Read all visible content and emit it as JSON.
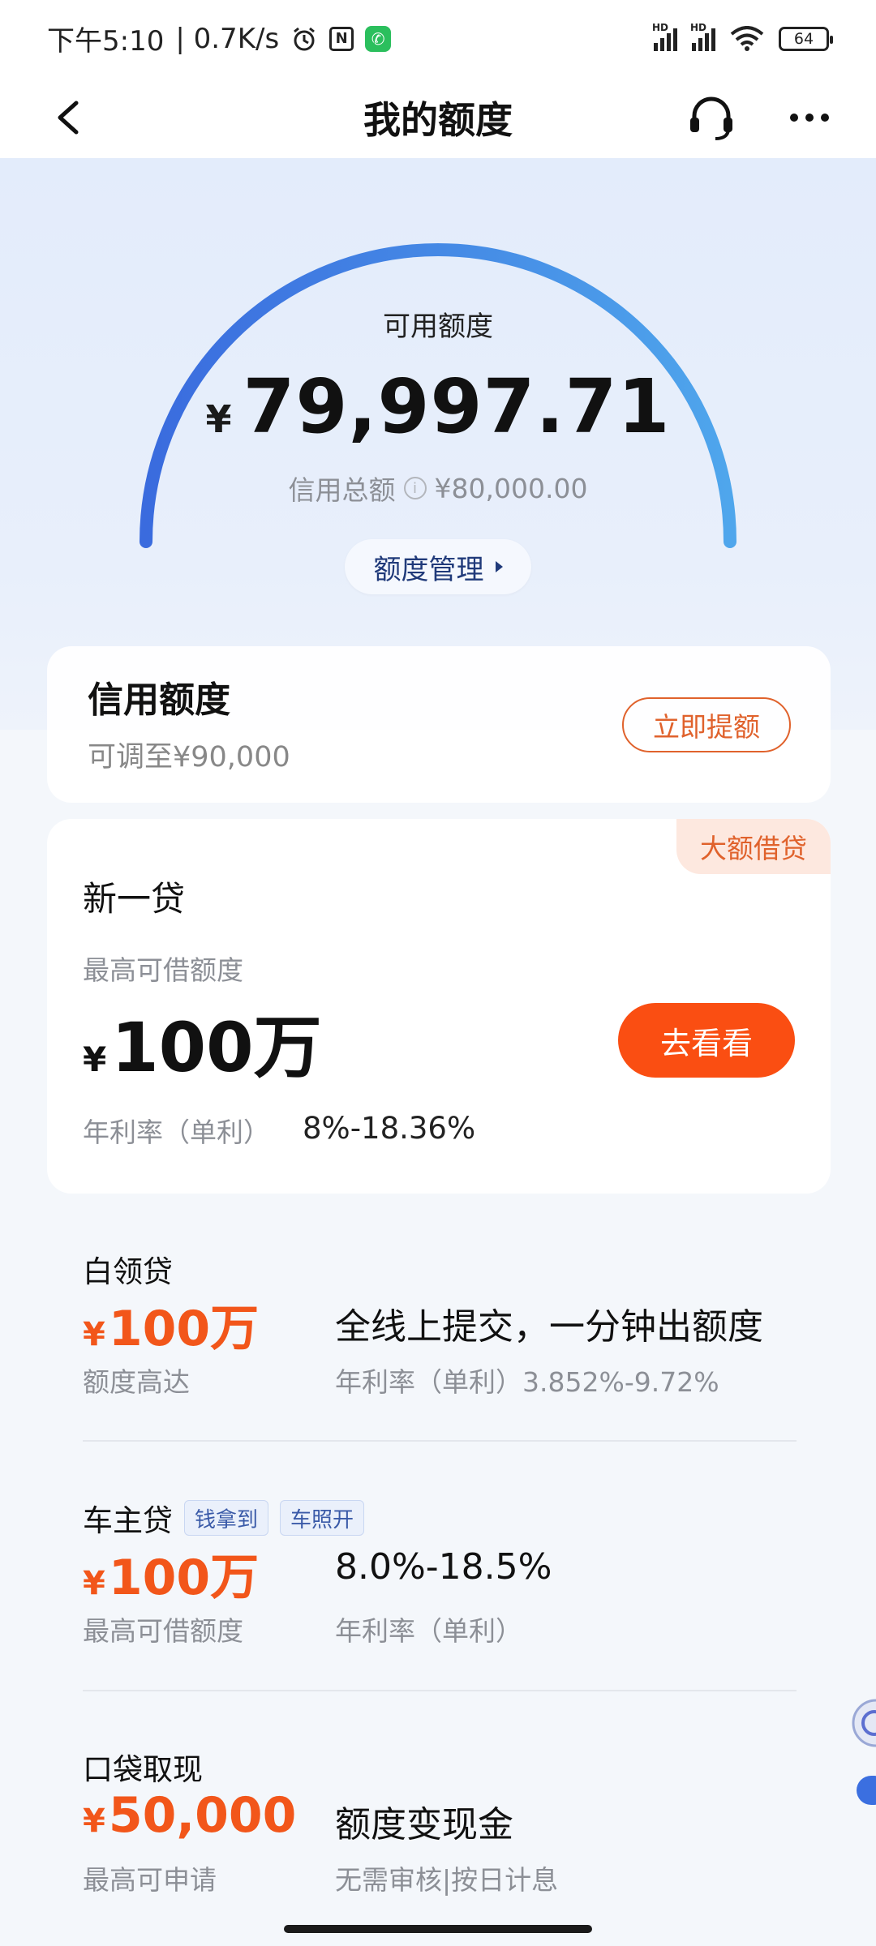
{
  "status_bar": {
    "time": "下午5:10",
    "net_speed": "| 0.7K/s",
    "signal_label": "HD",
    "battery": "64"
  },
  "nav": {
    "title": "我的额度"
  },
  "quota": {
    "label": "可用额度",
    "currency": "¥",
    "available": "79,997.71",
    "total_label": "信用总额",
    "total_value": "¥80,000.00",
    "manage_label": "额度管理",
    "gauge_colors": [
      "#3a6bde",
      "#4fa6ec"
    ]
  },
  "credit": {
    "title": "信用额度",
    "sub": "可调至¥90,000",
    "button": "立即提额"
  },
  "featured_loan": {
    "badge": "大额借贷",
    "title": "新一贷",
    "sub": "最高可借额度",
    "currency": "¥",
    "amount": "100万",
    "rate_label": "年利率（单利）",
    "rate": "8%-18.36%",
    "button": "去看看"
  },
  "products": [
    {
      "title": "白领贷",
      "currency": "¥",
      "amount": "100万",
      "left_sub": "额度高达",
      "desc": "全线上提交，一分钟出额度",
      "right_sub": "年利率（单利）3.852%-9.72%"
    },
    {
      "title": "车主贷",
      "tags": [
        "钱拿到",
        "车照开"
      ],
      "currency": "¥",
      "amount": "100万",
      "left_sub": "最高可借额度",
      "desc": "8.0%-18.5%",
      "right_sub": "年利率（单利）"
    },
    {
      "title": "口袋取现",
      "currency": "¥",
      "amount": "50,000",
      "left_sub": "最高可申请",
      "desc": "额度变现金",
      "right_sub": "无需审核|按日计息"
    }
  ],
  "accent": {
    "orange": "#f2561a",
    "button_orange": "#fa4e12",
    "navy": "#203a7a"
  }
}
